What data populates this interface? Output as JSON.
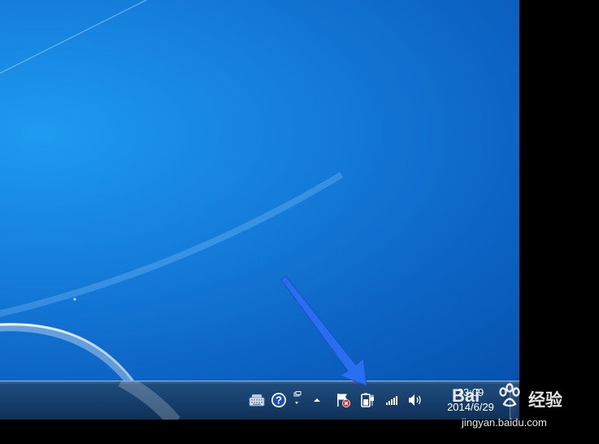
{
  "taskbar": {
    "tray_icons": [
      {
        "name": "keyboard-icon"
      },
      {
        "name": "help-icon",
        "glyph": "?"
      },
      {
        "name": "language-bar-icon"
      },
      {
        "name": "show-hidden-icons-icon"
      },
      {
        "name": "action-center-flag-icon"
      },
      {
        "name": "power-battery-icon"
      },
      {
        "name": "network-signal-icon"
      },
      {
        "name": "volume-icon"
      }
    ],
    "clock": {
      "time": "23:09",
      "date": "2014/6/29"
    }
  },
  "watermark": {
    "brand": "Bai",
    "suffix": "经验",
    "site": "jingyan.baidu.com"
  },
  "colors": {
    "desktop_blue": "#1681dd",
    "taskbar": "#163e6b",
    "arrow": "#2a6ef0"
  }
}
